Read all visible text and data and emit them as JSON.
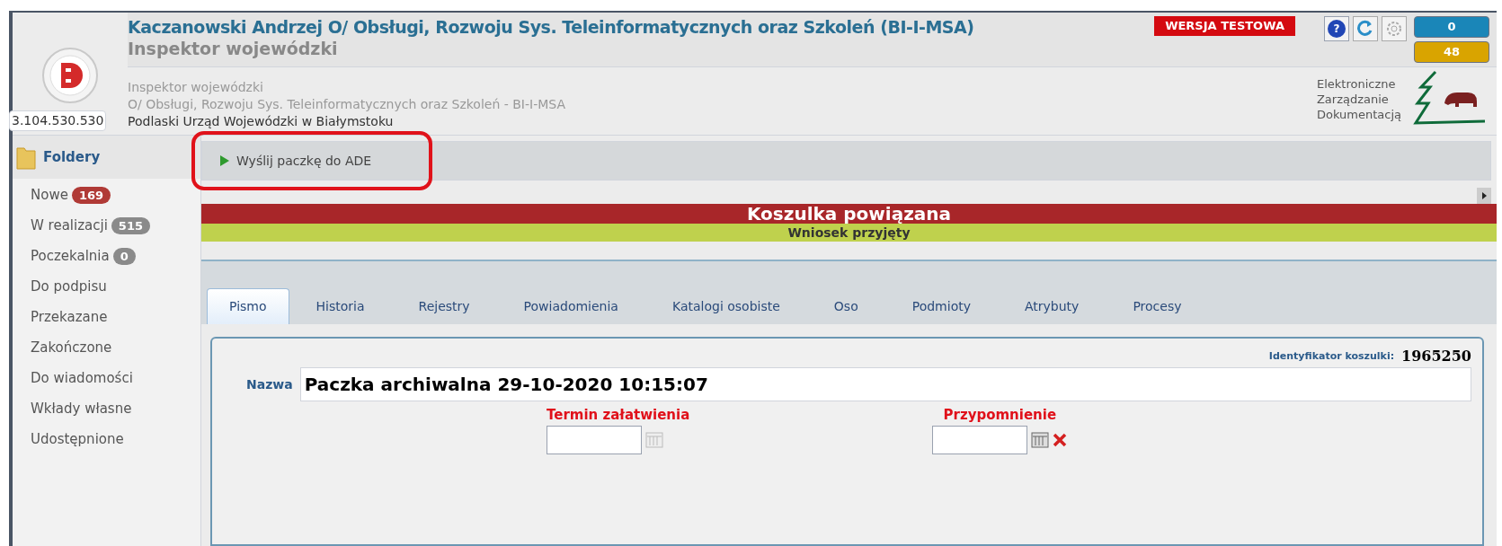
{
  "header": {
    "title": "Kaczanowski Andrzej O/ Obsługi, Rozwoju Sys. Teleinformatycznych oraz Szkoleń (BI-I-MSA)",
    "subtitle": "Inspektor wojewódzki",
    "test_badge": "WERSJA TESTOWA",
    "help_glyph": "?",
    "counters": [
      {
        "value": "0",
        "color": "#1a86b8"
      },
      {
        "value": "48",
        "color": "#d9a400"
      }
    ],
    "ip": "3.104.530.530",
    "details": [
      "Inspektor wojewódzki",
      "O/ Obsługi, Rozwoju Sys. Teleinformatycznych oraz Szkoleń - BI-I-MSA",
      "Podlaski Urząd Wojewódzki w Białymstoku"
    ],
    "brand": [
      "Elektroniczne",
      "Zarządzanie",
      "Dokumentacją"
    ]
  },
  "sidebar": {
    "title": "Foldery",
    "items": [
      {
        "label": "Nowe",
        "count": "169",
        "color": "#b03a36"
      },
      {
        "label": "W realizacji",
        "count": "515",
        "color": "#8a8a8a"
      },
      {
        "label": "Poczekalnia",
        "count": "0",
        "color": "#8a8a8a"
      },
      {
        "label": "Do podpisu"
      },
      {
        "label": "Przekazane"
      },
      {
        "label": "Zakończone"
      },
      {
        "label": "Do wiadomości"
      },
      {
        "label": "Wkłady własne"
      },
      {
        "label": "Udostępnione"
      }
    ]
  },
  "toolbar": {
    "button": "Wyślij paczkę do ADE",
    "highlighted": true
  },
  "banner": {
    "title": "Koszulka powiązana",
    "status": "Wniosek przyjęty"
  },
  "tabs": [
    {
      "label": "Pismo",
      "selected": true
    },
    {
      "label": "Historia",
      "selected": false
    },
    {
      "label": "Rejestry",
      "selected": false
    },
    {
      "label": "Powiadomienia",
      "selected": false
    },
    {
      "label": "Katalogi osobiste",
      "selected": false
    },
    {
      "label": "Oso",
      "selected": false
    },
    {
      "label": "Podmioty",
      "selected": false
    },
    {
      "label": "Atrybuty",
      "selected": false
    },
    {
      "label": "Procesy",
      "selected": false
    }
  ],
  "form": {
    "id_label": "Identyfikator koszulki:",
    "id_value": "1965250",
    "name_label": "Nazwa",
    "name_value": "Paczka archiwalna 29-10-2020 10:15:07",
    "dates": [
      {
        "label": "Termin załatwienia",
        "clearable": false
      },
      {
        "label": "Przypomnienie",
        "clearable": true
      }
    ]
  }
}
